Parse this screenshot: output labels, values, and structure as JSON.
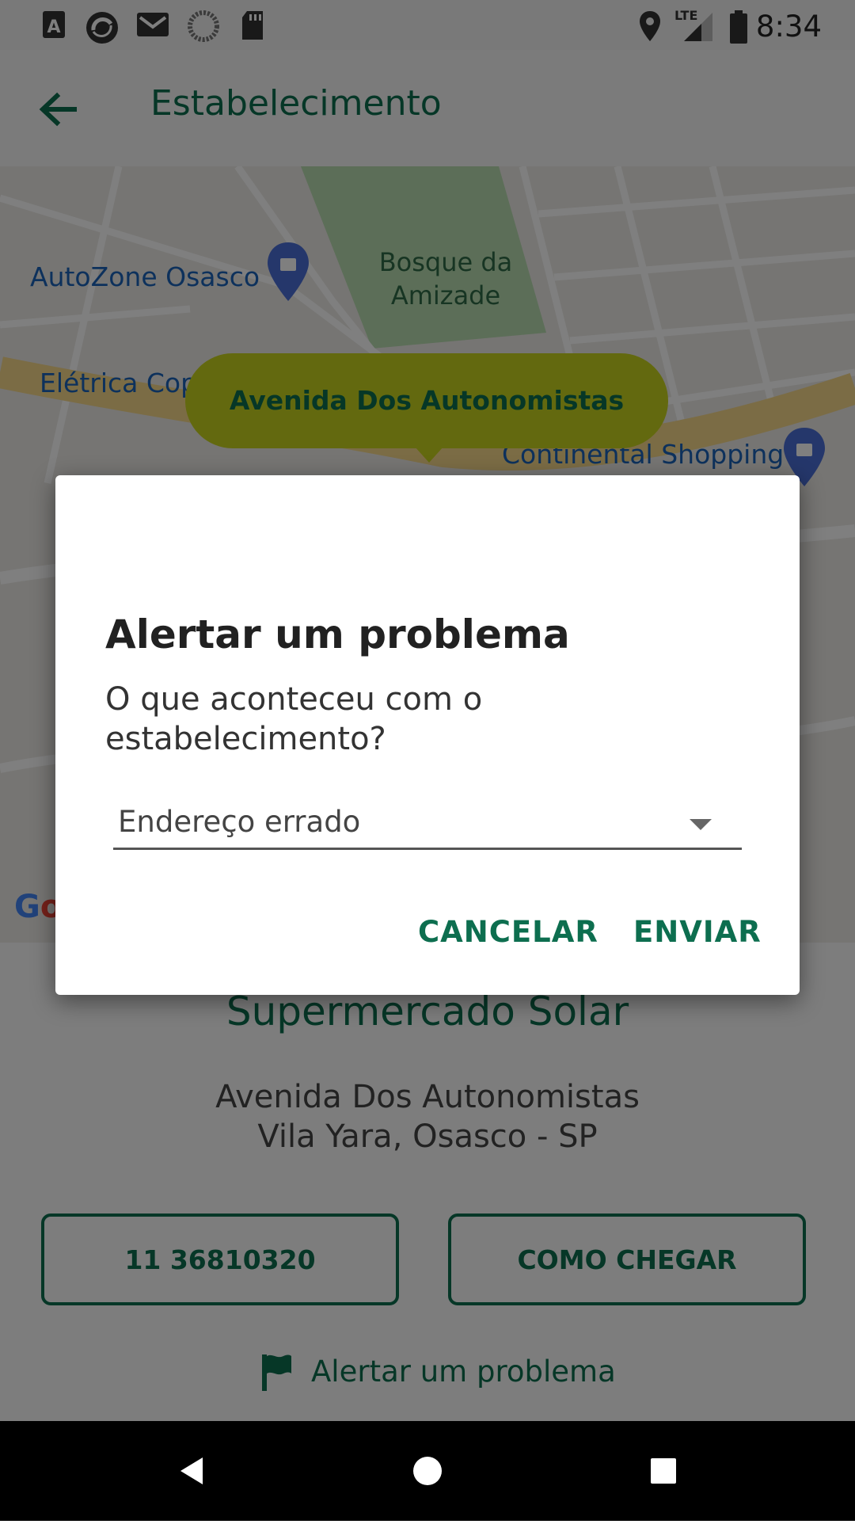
{
  "status_bar": {
    "time": "8:34",
    "network": "LTE",
    "left_icons": [
      "font-icon",
      "app-icon",
      "gmail-icon",
      "sync-icon",
      "sd-card-icon"
    ],
    "right_icons": [
      "location-icon",
      "signal-icon",
      "battery-icon"
    ]
  },
  "app_bar": {
    "title": "Estabelecimento",
    "back_icon": "arrow-back-icon"
  },
  "map": {
    "labels": {
      "autozone": "AutoZone Osasco",
      "park": "Bosque da Amizade",
      "eletrica": "Elétrica Cop",
      "shopping": "Continental Shopping"
    },
    "callout": "Avenida Dos Autonomistas",
    "google_logo": "Go"
  },
  "store": {
    "name": "Supermercado Solar",
    "address_line1": "Avenida Dos Autonomistas",
    "address_line2": "Vila Yara, Osasco - SP",
    "phone_button": "11 36810320",
    "directions_button": "COMO CHEGAR",
    "report_link": "Alertar um problema"
  },
  "dialog": {
    "title": "Alertar um problema",
    "message": "O que aconteceu com o estabelecimento?",
    "dropdown_selected": "Endereço errado",
    "cancel_label": "CANCELAR",
    "send_label": "ENVIAR"
  },
  "colors": {
    "primary_green": "#0d6e4f",
    "callout_yellow": "#c6d21f",
    "map_blue": "#1a62b8"
  }
}
